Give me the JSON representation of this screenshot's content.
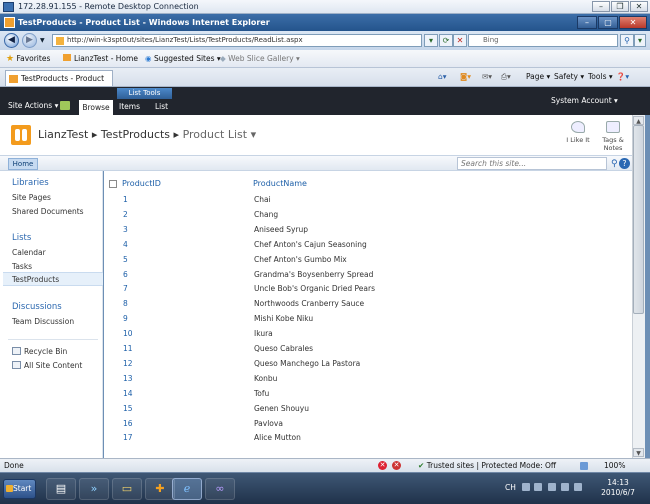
{
  "rdp": {
    "title": "172.28.91.155 - Remote Desktop Connection"
  },
  "ie": {
    "window_title": "TestProducts - Product List - Windows Internet Explorer",
    "url": "http://win-k3spt0ut/sites/LianzTest/Lists/TestProducts/ReadList.aspx",
    "search_placeholder": "Bing",
    "favorites_label": "Favorites",
    "favorites": [
      "LianzTest - Home",
      "Suggested Sites ▾",
      "Web Slice Gallery ▾"
    ],
    "tab_label": "TestProducts - Product List",
    "command_bar": [
      "Page ▾",
      "Safety ▾",
      "Tools ▾"
    ],
    "status_left": "Done",
    "status_zone": "Trusted sites | Protected Mode: Off",
    "zoom": "100%"
  },
  "ribbon": {
    "site_actions": "Site Actions ▾",
    "browse_tab": "Browse",
    "list_tools": "List Tools",
    "items_tab": "Items",
    "list_tab": "List",
    "system_account": "System Account ▾"
  },
  "breadcrumb": {
    "site": "LianzTest",
    "list": "TestProducts",
    "view": "Product List ▾"
  },
  "social": {
    "like": "I Like It",
    "tags_line1": "Tags &",
    "tags_line2": "Notes"
  },
  "topnav": {
    "home": "Home",
    "search_placeholder": "Search this site..."
  },
  "quicklaunch": {
    "libraries": "Libraries",
    "site_pages": "Site Pages",
    "shared_documents": "Shared Documents",
    "lists": "Lists",
    "calendar": "Calendar",
    "tasks": "Tasks",
    "testproducts": "TestProducts",
    "discussions": "Discussions",
    "team_discussion": "Team Discussion",
    "recycle_bin": "Recycle Bin",
    "all_site_content": "All Site Content"
  },
  "table": {
    "columns": [
      "ProductID",
      "ProductName"
    ],
    "rows": [
      [
        "1",
        "Chai"
      ],
      [
        "2",
        "Chang"
      ],
      [
        "3",
        "Aniseed Syrup"
      ],
      [
        "4",
        "Chef Anton's Cajun Seasoning"
      ],
      [
        "5",
        "Chef Anton's Gumbo Mix"
      ],
      [
        "6",
        "Grandma's Boysenberry Spread"
      ],
      [
        "7",
        "Uncle Bob's Organic Dried Pears"
      ],
      [
        "8",
        "Northwoods Cranberry Sauce"
      ],
      [
        "9",
        "Mishi Kobe Niku"
      ],
      [
        "10",
        "Ikura"
      ],
      [
        "11",
        "Queso Cabrales"
      ],
      [
        "12",
        "Queso Manchego La Pastora"
      ],
      [
        "13",
        "Konbu"
      ],
      [
        "14",
        "Tofu"
      ],
      [
        "15",
        "Genen Shouyu"
      ],
      [
        "16",
        "Pavlova"
      ],
      [
        "17",
        "Alice Mutton"
      ]
    ]
  },
  "taskbar": {
    "start": "Start",
    "lang": "CH",
    "time": "14:13",
    "date": "2010/6/7"
  }
}
